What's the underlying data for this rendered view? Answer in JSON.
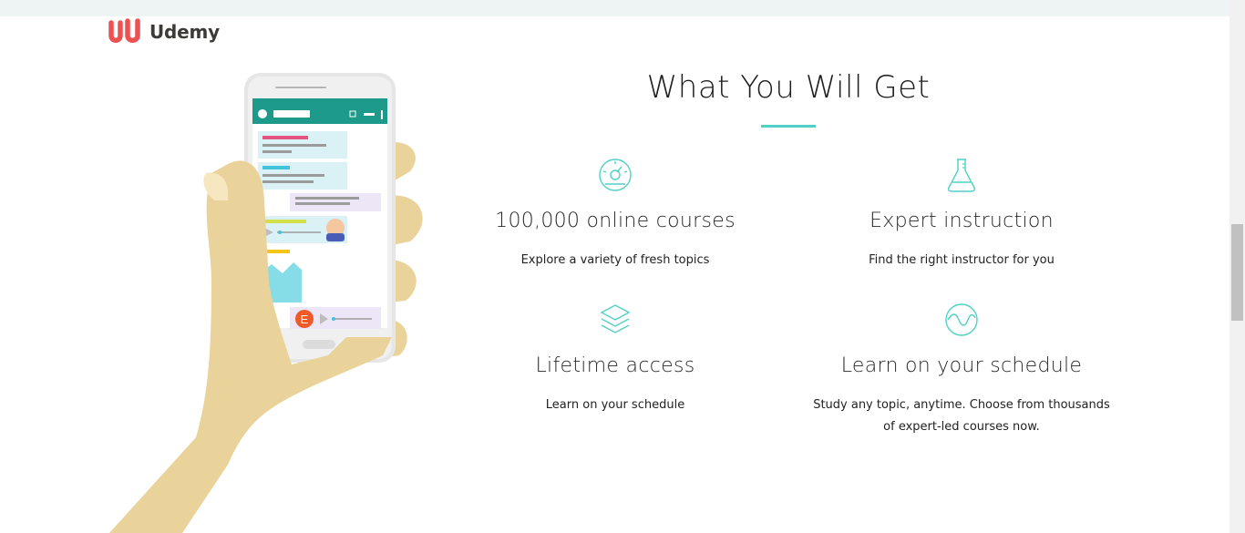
{
  "brand": {
    "name": "Udemy",
    "logo_color": "#ec5252",
    "text_color": "#3c3b37"
  },
  "section": {
    "title": "What You Will Get",
    "accent_color": "#4fd1c5"
  },
  "features": [
    {
      "icon": "speedometer-icon",
      "title": "100,000 online courses",
      "description": "Explore a variety of fresh topics"
    },
    {
      "icon": "flask-icon",
      "title": "Expert instruction",
      "description": "Find the right instructor for you"
    },
    {
      "icon": "layers-icon",
      "title": "Lifetime access",
      "description": "Learn on your schedule"
    },
    {
      "icon": "wave-icon",
      "title": "Learn on your schedule",
      "description": "Study any topic, anytime. Choose from thousands of expert-led courses now."
    }
  ],
  "illustration": {
    "icon": "hand-holding-phone-illustration",
    "avatar_letter": "E"
  }
}
